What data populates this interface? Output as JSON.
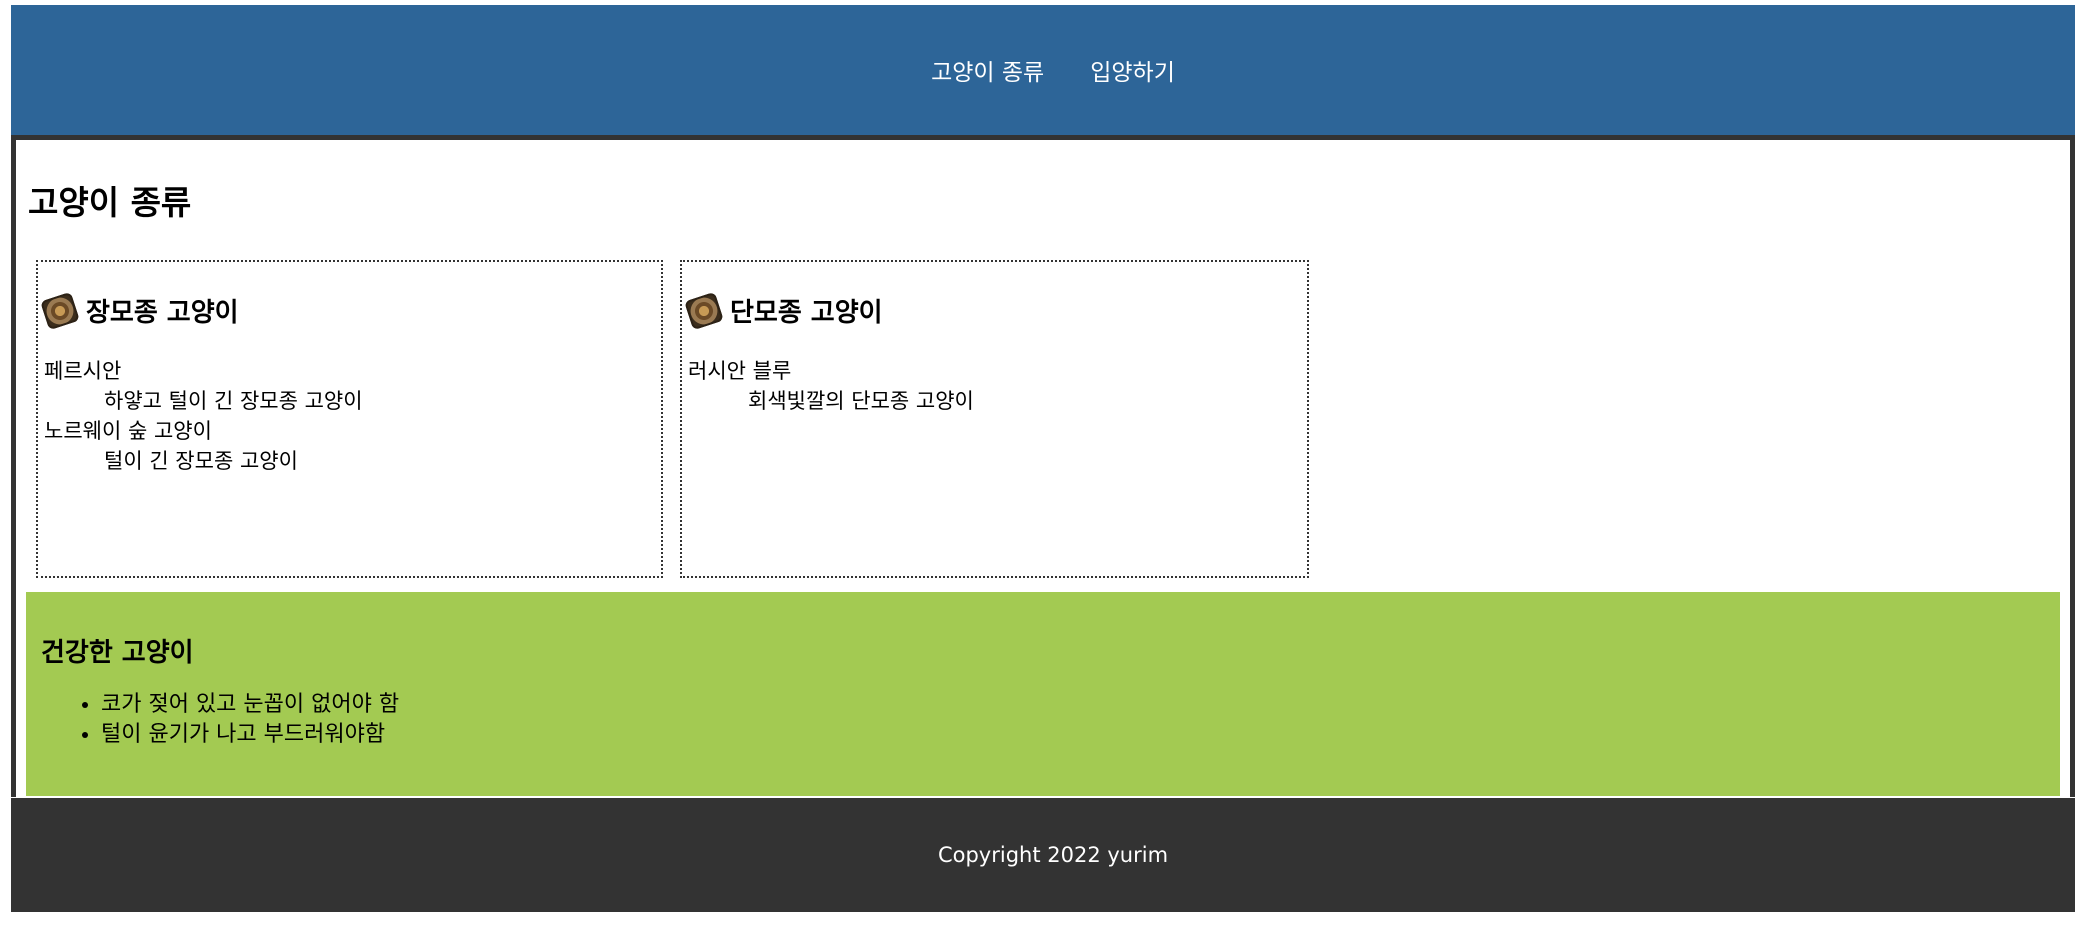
{
  "nav": {
    "items": [
      {
        "label": "고양이 종류"
      },
      {
        "label": "입양하기"
      }
    ]
  },
  "main": {
    "title": "고양이 종류",
    "cards": [
      {
        "heading": "장모종 고양이",
        "icon": "badge-icon",
        "entries": [
          {
            "term": "페르시안",
            "desc": "하얗고 털이 긴 장모종 고양이"
          },
          {
            "term": "노르웨이 숲 고양이",
            "desc": "털이 긴 장모종 고양이"
          }
        ]
      },
      {
        "heading": "단모종 고양이",
        "icon": "badge-icon",
        "entries": [
          {
            "term": "러시안 블루",
            "desc": "회색빛깔의 단모종 고양이"
          }
        ]
      }
    ],
    "health": {
      "heading": "건강한 고양이",
      "items": [
        "코가 젖어 있고 눈꼽이 없어야 함",
        "털이 윤기가 나고 부드러워야함"
      ]
    }
  },
  "footer": {
    "text": "Copyright 2022 yurim"
  },
  "colors": {
    "header_bg": "#2d6598",
    "footer_bg": "#333333",
    "health_bg": "#a3ca52"
  }
}
